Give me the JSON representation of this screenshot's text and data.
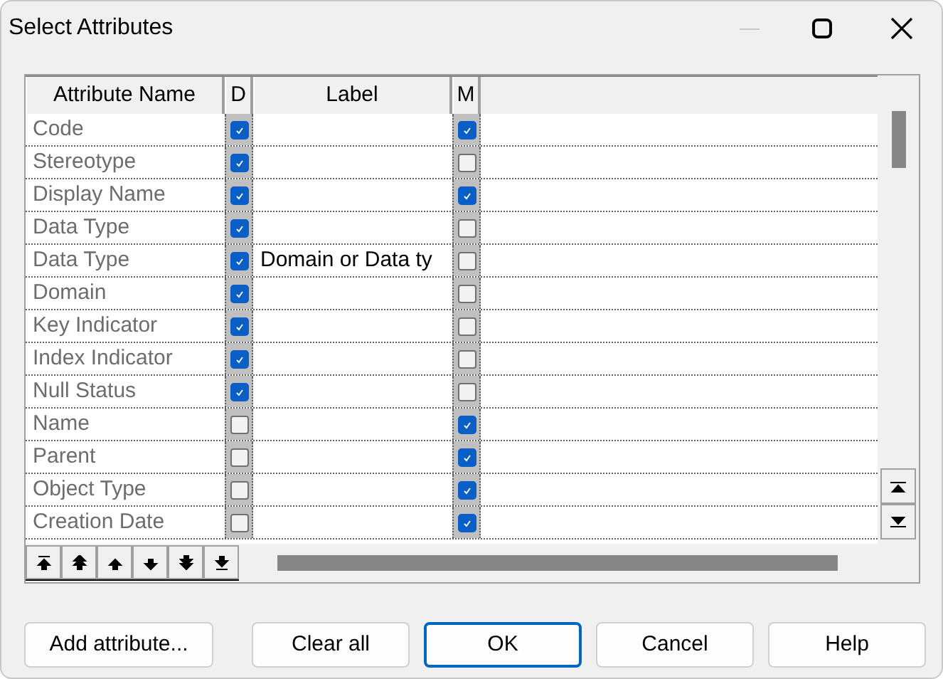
{
  "window": {
    "title": "Select Attributes"
  },
  "table": {
    "columns": [
      "Attribute Name",
      "D",
      "Label",
      "M"
    ],
    "rows": [
      {
        "name": "Code",
        "d_checked": true,
        "label": "",
        "m_checked": true
      },
      {
        "name": "Stereotype",
        "d_checked": true,
        "label": "",
        "m_checked": false
      },
      {
        "name": "Display Name",
        "d_checked": true,
        "label": "",
        "m_checked": true
      },
      {
        "name": "Data Type",
        "d_checked": true,
        "label": "",
        "m_checked": false
      },
      {
        "name": "Data Type",
        "d_checked": true,
        "label": "Domain or Data ty",
        "m_checked": false
      },
      {
        "name": "Domain",
        "d_checked": true,
        "label": "",
        "m_checked": false
      },
      {
        "name": "Key Indicator",
        "d_checked": true,
        "label": "",
        "m_checked": false
      },
      {
        "name": "Index Indicator",
        "d_checked": true,
        "label": "",
        "m_checked": false
      },
      {
        "name": "Null Status",
        "d_checked": true,
        "label": "",
        "m_checked": false
      },
      {
        "name": "Name",
        "d_checked": false,
        "label": "",
        "m_checked": true
      },
      {
        "name": "Parent",
        "d_checked": false,
        "label": "",
        "m_checked": true
      },
      {
        "name": "Object Type",
        "d_checked": false,
        "label": "",
        "m_checked": true
      },
      {
        "name": "Creation Date",
        "d_checked": false,
        "label": "",
        "m_checked": true
      }
    ]
  },
  "buttons": [
    {
      "label": "Add attribute...",
      "default": false
    },
    {
      "label": "Clear all",
      "default": false
    },
    {
      "label": "OK",
      "default": true
    },
    {
      "label": "Cancel",
      "default": false
    },
    {
      "label": "Help",
      "default": false
    }
  ]
}
